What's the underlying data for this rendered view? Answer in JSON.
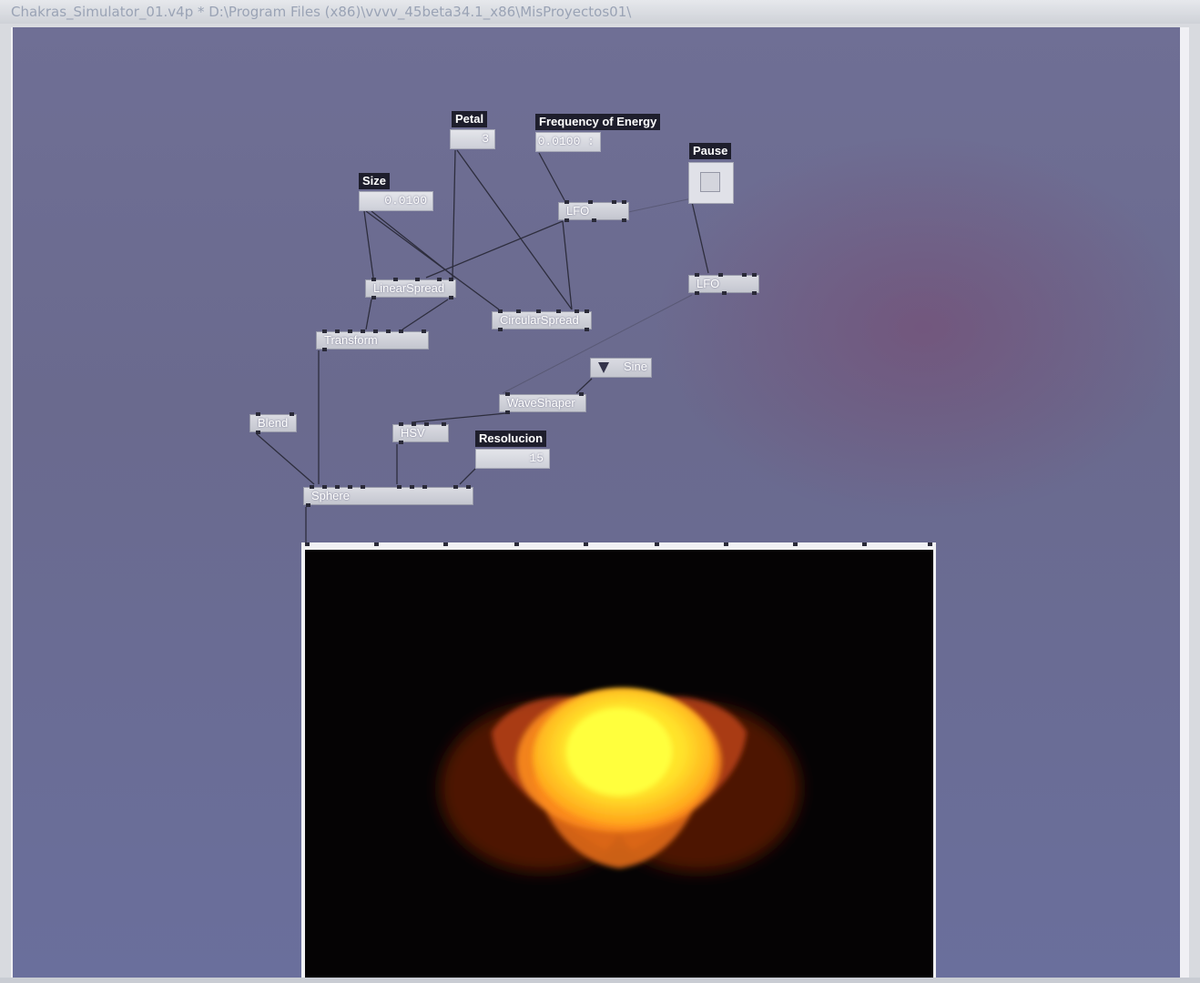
{
  "window": {
    "title": "Chakras_Simulator_01.v4p *  D:\\Program Files (x86)\\vvvv_45beta34.1_x86\\MisProyectos01\\"
  },
  "labels": {
    "petal": "Petal",
    "frequency": "Frequency of Energy",
    "size": "Size",
    "pause": "Pause",
    "resolucion": "Resolucion"
  },
  "values": {
    "petal": "3",
    "frequency": "0.0100 :",
    "size": "0.0100",
    "resolucion": "15",
    "pause_state": "off"
  },
  "nodes": {
    "lfo_1": "LFO",
    "lfo_2": "LFO",
    "linearspread": "LinearSpread",
    "circularspread": "CircularSpread",
    "transform": "Transform",
    "sine": "Sine",
    "waveshaper": "WaveShaper",
    "blend": "Blend",
    "hsv": "HSV",
    "sphere": "Sphere"
  },
  "colors": {
    "patch_background": "#6c6c92",
    "node_fill": "#cfd1da",
    "label_fill": "#1e1e2c",
    "render_background": "#050304",
    "glow_core": "#ffee22",
    "glow_mid": "#ff9a1a",
    "glow_outer": "#7a1f08"
  },
  "icons": {
    "enum_dropdown": "triangle-down-icon",
    "toggle": "checkbox-icon"
  }
}
